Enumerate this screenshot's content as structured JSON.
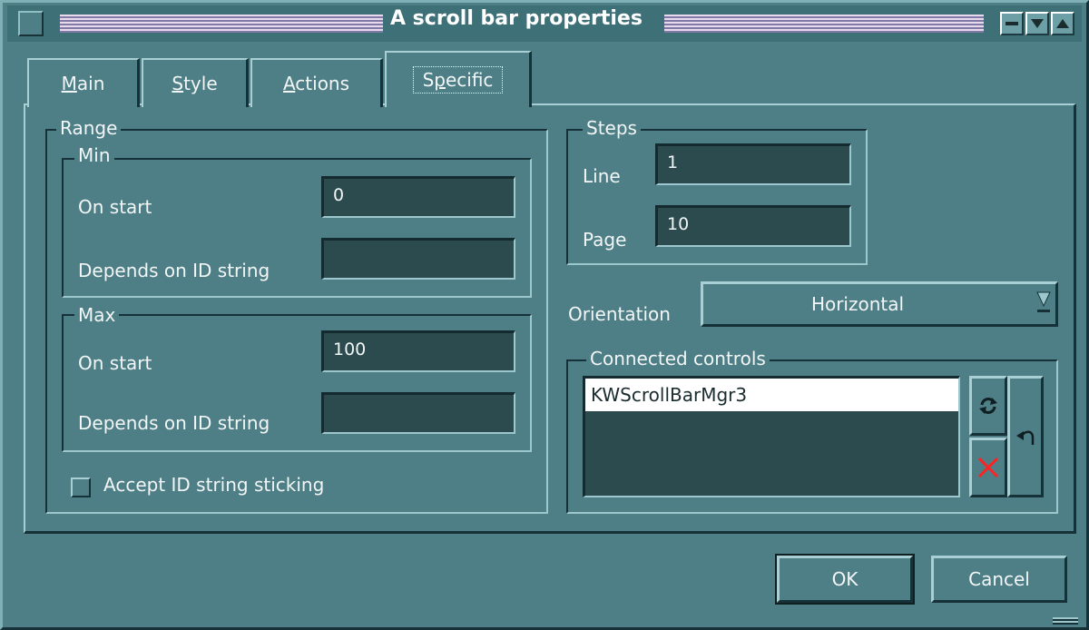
{
  "window": {
    "title": "A scroll bar properties"
  },
  "tabs": [
    {
      "label": "Main",
      "mnemonic": "M",
      "rest": "ain"
    },
    {
      "label": "Style",
      "mnemonic": "S",
      "rest": "tyle"
    },
    {
      "label": "Actions",
      "mnemonic": "A",
      "rest": "ctions"
    },
    {
      "label": "Specific",
      "pre": "S",
      "mnemonic": "p",
      "rest": "ecific"
    }
  ],
  "range": {
    "legend": "Range",
    "min": {
      "legend": "Min",
      "on_start_label": "On start",
      "on_start_value": "0",
      "depends_label": "Depends on ID string",
      "depends_value": ""
    },
    "max": {
      "legend": "Max",
      "on_start_label": "On start",
      "on_start_value": "100",
      "depends_label": "Depends on ID string",
      "depends_value": ""
    },
    "accept_label": "Accept ID string sticking"
  },
  "steps": {
    "legend": "Steps",
    "line_label": "Line",
    "line_value": "1",
    "page_label": "Page",
    "page_value": "10"
  },
  "orientation": {
    "label": "Orientation",
    "value": "Horizontal"
  },
  "connected": {
    "legend": "Connected controls",
    "items": [
      "KWScrollBarMgr3"
    ]
  },
  "buttons": {
    "ok": "OK",
    "cancel": "Cancel"
  },
  "colors": {
    "background": "#4e7f86",
    "field": "#2c4b4f",
    "title_stripes": "#b8a4c8",
    "delete_x": "#ff2222"
  }
}
